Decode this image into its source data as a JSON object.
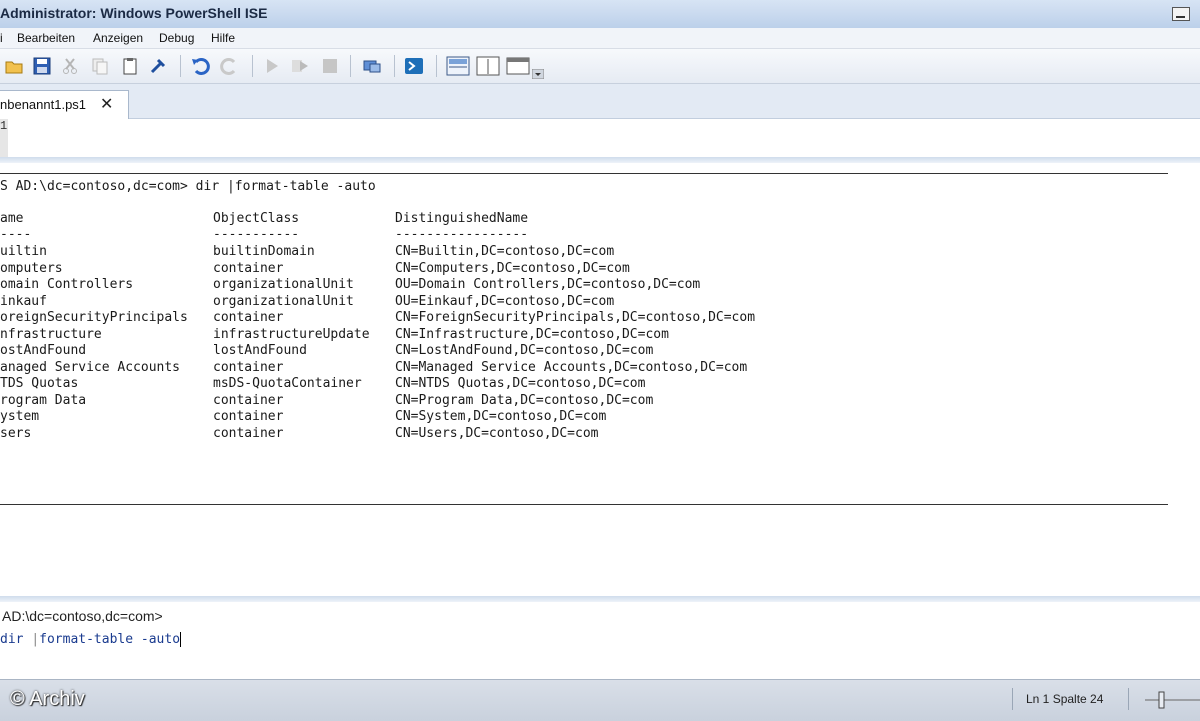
{
  "window": {
    "title": "Administrator: Windows PowerShell ISE"
  },
  "menu": [
    "i",
    "Bearbeiten",
    "Anzeigen",
    "Debug",
    "Hilfe"
  ],
  "toolbar_icons": [
    "open-icon",
    "save-icon",
    "cut-icon",
    "copy-icon",
    "paste-icon",
    "clear-icon",
    "undo-icon",
    "redo-icon",
    "run-icon",
    "run-selection-icon",
    "stop-icon",
    "remote-tab-icon",
    "powershell-icon",
    "layout-top-icon",
    "layout-right-icon",
    "layout-max-icon"
  ],
  "tab": {
    "label": "nbenannt1.ps1",
    "close": "✕"
  },
  "script": {
    "line_number": "1"
  },
  "output": {
    "command_line": "S AD:\\dc=contoso,dc=com> dir |format-table -auto",
    "headers": [
      "ame",
      "ObjectClass",
      "DistinguishedName"
    ],
    "dashes": [
      "----",
      "-----------",
      "-----------------"
    ],
    "rows": [
      [
        "uiltin",
        "builtinDomain",
        "CN=Builtin,DC=contoso,DC=com"
      ],
      [
        "omputers",
        "container",
        "CN=Computers,DC=contoso,DC=com"
      ],
      [
        "omain Controllers",
        "organizationalUnit",
        "OU=Domain Controllers,DC=contoso,DC=com"
      ],
      [
        "inkauf",
        "organizationalUnit",
        "OU=Einkauf,DC=contoso,DC=com"
      ],
      [
        "oreignSecurityPrincipals",
        "container",
        "CN=ForeignSecurityPrincipals,DC=contoso,DC=com"
      ],
      [
        "nfrastructure",
        "infrastructureUpdate",
        "CN=Infrastructure,DC=contoso,DC=com"
      ],
      [
        "ostAndFound",
        "lostAndFound",
        "CN=LostAndFound,DC=contoso,DC=com"
      ],
      [
        "anaged Service Accounts",
        "container",
        "CN=Managed Service Accounts,DC=contoso,DC=com"
      ],
      [
        "TDS Quotas",
        "msDS-QuotaContainer",
        "CN=NTDS Quotas,DC=contoso,DC=com"
      ],
      [
        "rogram Data",
        "container",
        "CN=Program Data,DC=contoso,DC=com"
      ],
      [
        "ystem",
        "container",
        "CN=System,DC=contoso,DC=com"
      ],
      [
        "sers",
        "container",
        "CN=Users,DC=contoso,DC=com"
      ]
    ]
  },
  "command": {
    "prompt": "AD:\\dc=contoso,dc=com>",
    "input_cmd": "dir",
    "input_pipe": "|",
    "input_fmt": "format-table",
    "input_param": "-auto"
  },
  "status": {
    "copyright": "© Archiv",
    "position": "Ln 1  Spalte 24"
  }
}
